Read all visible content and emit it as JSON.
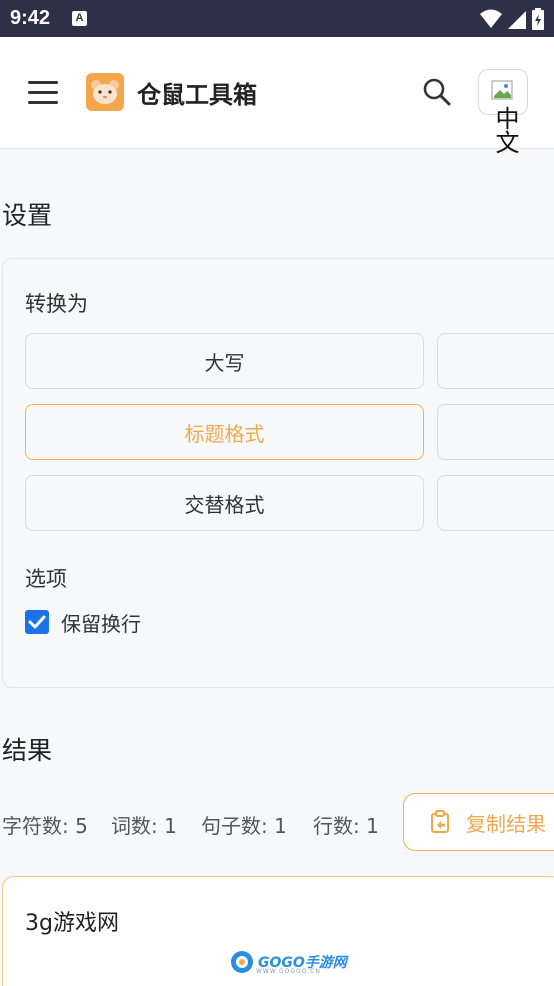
{
  "status_bar": {
    "time": "9:42",
    "notif_glyph": "A"
  },
  "header": {
    "title": "仓鼠工具箱",
    "language_label": "中文",
    "icons": {
      "menu": "menu-icon",
      "logo": "hamster-logo",
      "search": "search-icon"
    }
  },
  "settings": {
    "section_title": "设置",
    "convert_label": "转换为",
    "options": [
      {
        "label": "大写",
        "active": false
      },
      {
        "label": "",
        "active": false
      },
      {
        "label": "标题格式",
        "active": true
      },
      {
        "label": "",
        "active": false
      },
      {
        "label": "交替格式",
        "active": false
      },
      {
        "label": "",
        "active": false
      }
    ],
    "options_label": "选项",
    "keep_linebreaks": {
      "label": "保留换行",
      "checked": true
    }
  },
  "results": {
    "section_title": "结果",
    "stats": {
      "chars": "字符数: 5",
      "words": "词数: 1",
      "sentences": "句子数: 1",
      "lines": "行数: 1"
    },
    "copy_label": "复制结果",
    "output_text": "3g游戏网"
  },
  "watermark": {
    "brand": "GOGO手游网",
    "domain": "WWW.GOGOO.CN"
  },
  "colors": {
    "accent": "#f2a94e",
    "checkbox": "#1a73e8",
    "status_bar": "#2e3047"
  }
}
